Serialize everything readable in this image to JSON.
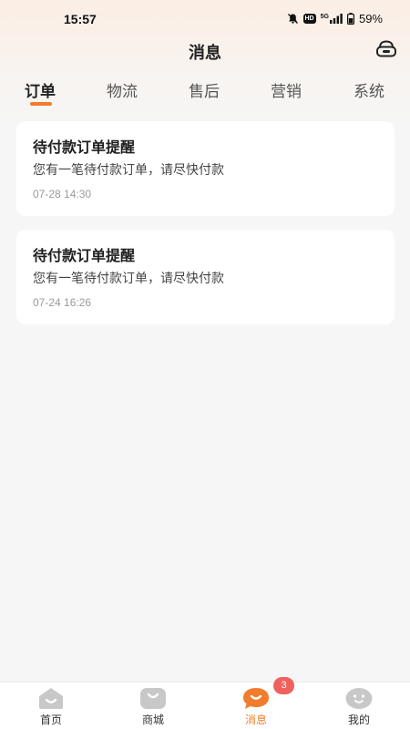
{
  "status_bar": {
    "time": "15:57",
    "network": "5G",
    "hd": "HD",
    "battery": "59%"
  },
  "header": {
    "title": "消息",
    "service_icon": "customer-service-icon"
  },
  "tabs": [
    {
      "label": "订单",
      "active": true
    },
    {
      "label": "物流",
      "active": false
    },
    {
      "label": "售后",
      "active": false
    },
    {
      "label": "营销",
      "active": false
    },
    {
      "label": "系统",
      "active": false
    }
  ],
  "messages": [
    {
      "title": "待付款订单提醒",
      "body": "您有一笔待付款订单，请尽快付款",
      "time": "07-28 14:30"
    },
    {
      "title": "待付款订单提醒",
      "body": "您有一笔待付款订单，请尽快付款",
      "time": "07-24 16:26"
    }
  ],
  "bottom_nav": {
    "items": [
      {
        "label": "首页",
        "icon": "home-icon",
        "active": false
      },
      {
        "label": "商城",
        "icon": "shop-icon",
        "active": false
      },
      {
        "label": "消息",
        "icon": "message-icon",
        "active": true
      },
      {
        "label": "我的",
        "icon": "profile-icon",
        "active": false
      }
    ],
    "badge": "3"
  },
  "colors": {
    "accent": "#f07c2c",
    "badge": "#f0615d",
    "inactive_icon": "#c8c8c8"
  }
}
